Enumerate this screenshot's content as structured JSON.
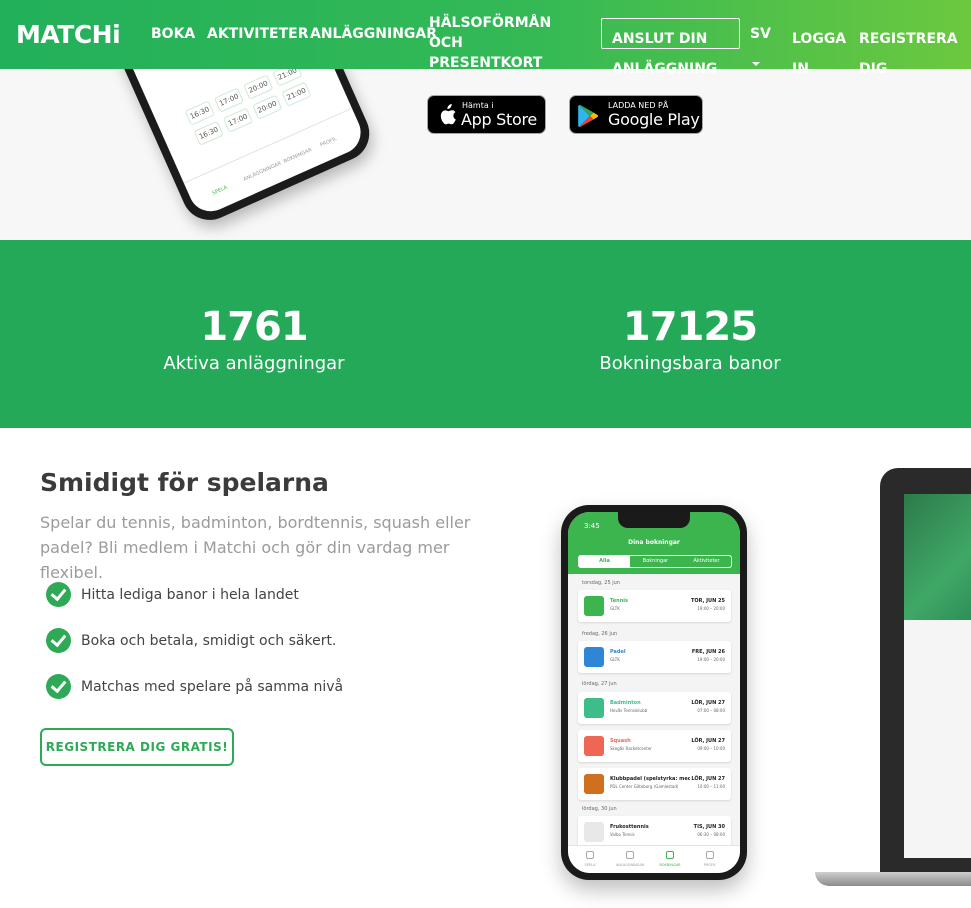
{
  "header": {
    "logo": "MATCHi",
    "nav": {
      "boka": "BOKA",
      "aktiviteter": "AKTIVITETER",
      "anlaggningar": "ANLÄGGNINGAR",
      "halsoforman": "HÄLSOFÖRMÅN OCH PRESENTKORT",
      "anslut": "ANSLUT DIN ANLÄGGNING",
      "language": "SV",
      "logga_in": "LOGGA IN",
      "registrera": "REGISTRERA DIG"
    },
    "colors": {
      "gradient_start": "#22b05b",
      "gradient_end": "#6cc83f"
    }
  },
  "top": {
    "phone_slots": [
      "16:30",
      "17:00",
      "20:00",
      "21:00",
      "16:30",
      "17:00",
      "20:00",
      "21:00"
    ],
    "phone_tabs": [
      "SPELA",
      "ANLÄGGNINGAR",
      "BOKNINGAR",
      "PROFIL"
    ],
    "app_store": {
      "small": "Hämta i",
      "big": "App Store"
    },
    "google_play": {
      "small": "LADDA NED PÅ",
      "big": "Google Play"
    }
  },
  "stats": {
    "background": "#24a959",
    "items": [
      {
        "number": "1761",
        "label": "Aktiva anläggningar"
      },
      {
        "number": "17125",
        "label": "Bokningsbara banor"
      }
    ]
  },
  "players": {
    "title": "Smidigt för spelarna",
    "lead": "Spelar du tennis, badminton, bordtennis, squash eller padel? Bli medlem i Matchi och gör din vardag mer flexibel.",
    "features": [
      "Hitta lediga banor i hela landet",
      "Boka och betala, smidigt och säkert.",
      "Matchas med spelare på samma nivå"
    ],
    "cta": "REGISTRERA DIG GRATIS!"
  },
  "phone": {
    "time": "3:45",
    "title": "Dina bokningar",
    "segments": [
      "Alla",
      "Bokningar",
      "Aktiviteter"
    ],
    "days": [
      "torsdag, 25 jun",
      "fredag, 26 jun",
      "lördag, 27 jun",
      "lördag, 30 jun"
    ],
    "bookings": [
      {
        "sport": "Tennis",
        "venue": "GLTK",
        "date": "TOR, JUN 25",
        "time": "19:00 – 20:00",
        "color": "#3cb54f"
      },
      {
        "sport": "Padel",
        "venue": "GLTK",
        "date": "FRE, JUN 26",
        "time": "19:00 – 20:00",
        "color": "#2f86d6"
      },
      {
        "sport": "Badminton",
        "venue": "Hovås Tennisklubb",
        "date": "LÖR, JUN 27",
        "time": "07:00 – 08:00",
        "color": "#3dbd8a"
      },
      {
        "sport": "Squash",
        "venue": "Skogås Racketcenter",
        "date": "LÖR, JUN 27",
        "time": "09:00 – 10:00",
        "color": "#ef6655"
      },
      {
        "sport": "Klubbpadel (spelstyrka: med...",
        "venue": "PDL Center Göteborg (Gamlestad)",
        "date": "LÖR, JUN 27",
        "time": "10:00 – 11:00",
        "color": "#d0701e"
      },
      {
        "sport": "Frukosttennis",
        "venue": "Valbo Tennis",
        "date": "TIS, JUN 30",
        "time": "06:30 – 08:00",
        "color": "#e8e8e8"
      }
    ],
    "tabs": [
      "SPELA",
      "ANLÄGGNINGAR",
      "BOKNINGAR",
      "PROFIL"
    ]
  }
}
